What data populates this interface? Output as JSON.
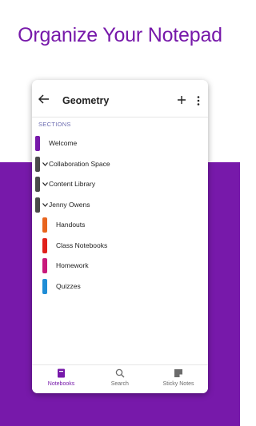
{
  "promo": {
    "title": "Organize Your Notepad"
  },
  "appbar": {
    "title": "Geometry"
  },
  "sections": {
    "label": "SECTIONS",
    "items": [
      {
        "label": "Welcome",
        "color": "#7719aa",
        "group": false,
        "indent": false
      },
      {
        "label": "Collaboration Space",
        "color": "#4a4a4a",
        "group": true,
        "indent": false
      },
      {
        "label": "Content Library",
        "color": "#4a4a4a",
        "group": true,
        "indent": false
      },
      {
        "label": "Jenny Owens",
        "color": "#4a4a4a",
        "group": true,
        "indent": false
      },
      {
        "label": "Handouts",
        "color": "#e8641e",
        "group": false,
        "indent": true
      },
      {
        "label": "Class Notebooks",
        "color": "#e0201b",
        "group": false,
        "indent": true
      },
      {
        "label": "Homework",
        "color": "#c8197b",
        "group": false,
        "indent": true
      },
      {
        "label": "Quizzes",
        "color": "#1f8dd6",
        "group": false,
        "indent": true
      }
    ]
  },
  "bottom_nav": [
    {
      "label": "Notebooks",
      "icon": "notebook-icon",
      "active": true
    },
    {
      "label": "Search",
      "icon": "search-icon",
      "active": false
    },
    {
      "label": "Sticky Notes",
      "icon": "sticky-note-icon",
      "active": false
    }
  ],
  "colors": {
    "accent": "#7719aa"
  }
}
